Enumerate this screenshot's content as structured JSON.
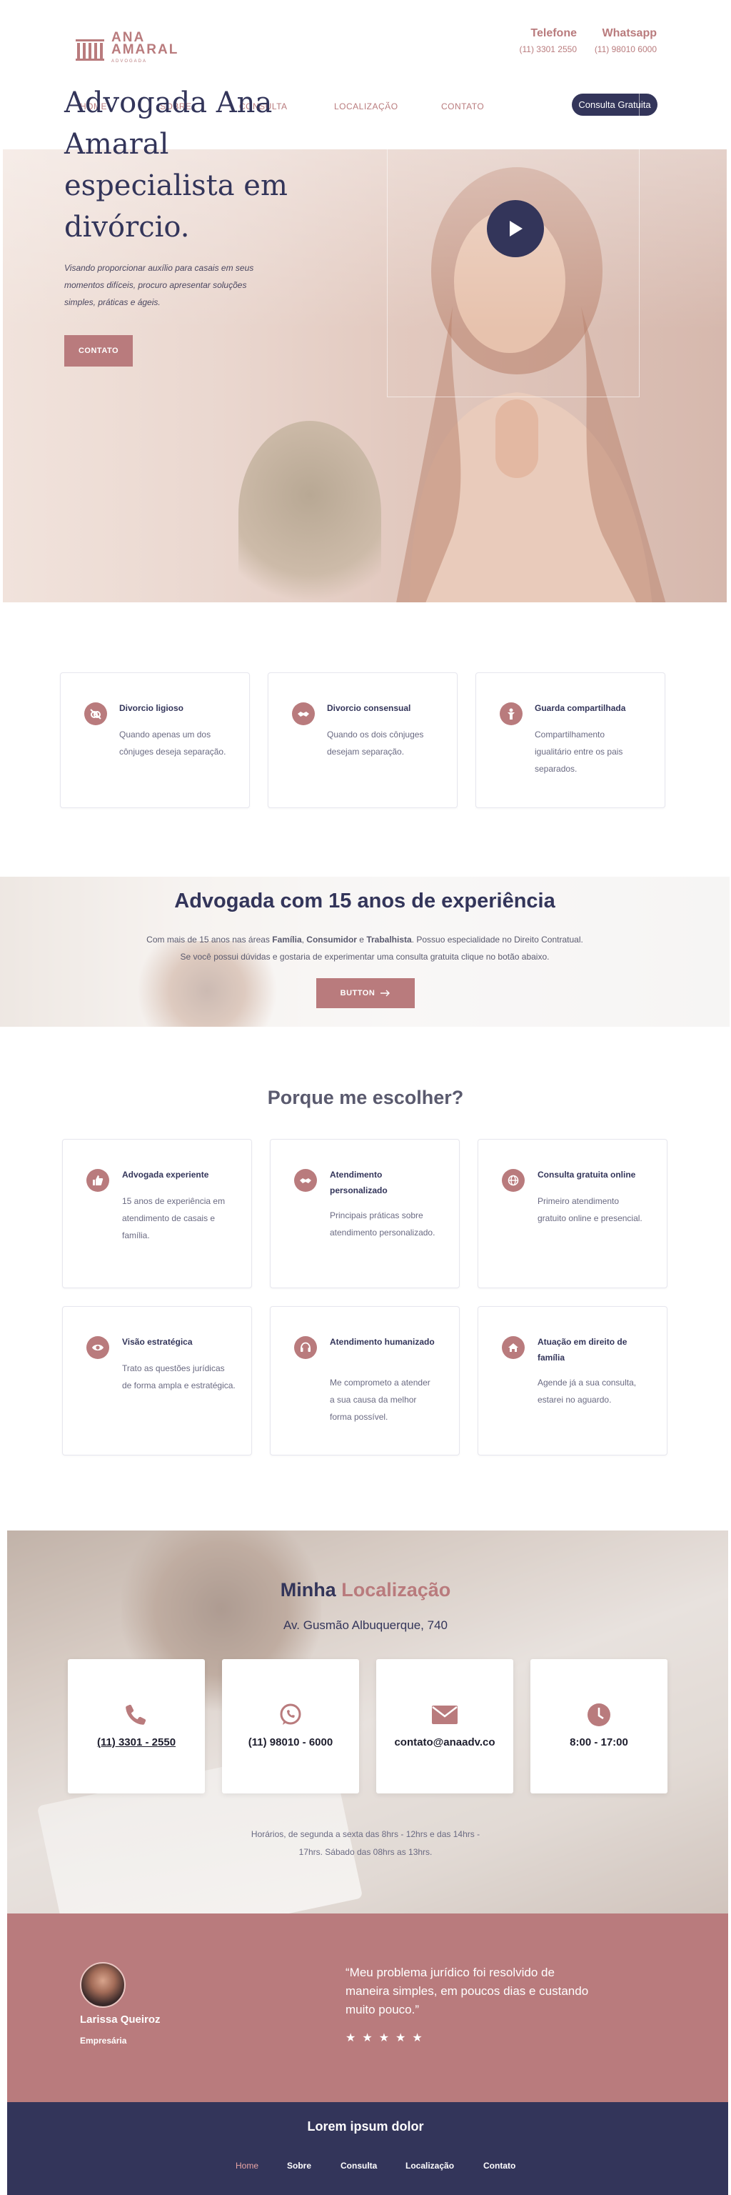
{
  "brand": {
    "line1": "ANA",
    "line2": "AMARAL",
    "line3": "ADVOGADA"
  },
  "contacts": [
    {
      "label": "Telefone",
      "value": "(11) 3301 2550"
    },
    {
      "label": "Whatsapp",
      "value": "(11) 98010 6000"
    }
  ],
  "nav": [
    "HOME",
    "SOBRE",
    "CONSULTA",
    "LOCALIZAÇÃO",
    "CONTATO"
  ],
  "nav_cta": "Consulta Gratuita",
  "hero": {
    "title": "Advogada Ana Amaral especialista em divórcio.",
    "subtitle": "Visando proporcionar auxílio para casais em seus momentos difíceis, procuro apresentar soluções simples, práticas e ágeis.",
    "button": "CONTATO",
    "play_icon": "play-icon"
  },
  "services": [
    {
      "icon": "no-rings-icon",
      "title": "Divorcio ligioso",
      "desc": "Quando apenas um dos cônjuges deseja separação."
    },
    {
      "icon": "handshake-icon",
      "title": "Divorcio consensual",
      "desc": "Quando os dois cônjuges desejam separação."
    },
    {
      "icon": "child-icon",
      "title": "Guarda compartilhada",
      "desc": "Compartilhamento igualitário entre os pais separados."
    }
  ],
  "experience": {
    "title": "Advogada com 15 anos de experiência",
    "line1_pre": "Com mais de 15 anos nas áreas ",
    "line1_b1": "Família",
    "line1_sep1": ", ",
    "line1_b2": "Consumidor",
    "line1_sep2": " e ",
    "line1_b3": "Trabalhista",
    "line1_post": ". Possuo especialidade no Direito Contratual.",
    "line2": "Se você possui dúvidas e gostaria de experimentar uma consulta gratuita clique no botão abaixo.",
    "button": "BUTTON",
    "button_icon": "arrow-right-icon"
  },
  "why": {
    "title": "Porque me escolher?",
    "items": [
      {
        "icon": "thumbs-up-icon",
        "title": "Advogada experiente",
        "desc": "15 anos de experiência em atendimento de casais e família."
      },
      {
        "icon": "handshake-icon",
        "title": "Atendimento personalizado",
        "desc": "Principais práticas sobre atendimento personalizado."
      },
      {
        "icon": "globe-icon",
        "title": "Consulta gratuita online",
        "desc": "Primeiro atendimento gratuito online e presencial."
      },
      {
        "icon": "eye-icon",
        "title": "Visão estratégica",
        "desc": "Trato as questões jurídicas de forma ampla e estratégica."
      },
      {
        "icon": "headset-icon",
        "title": "Atendimento humanizado",
        "desc": "Me comprometo a atender a sua causa da melhor forma possível."
      },
      {
        "icon": "home-icon",
        "title": "Atuação em direito de família",
        "desc": "Agende já a sua consulta, estarei no aguardo."
      }
    ]
  },
  "location": {
    "title_a": "Minha",
    "title_b": "Localização",
    "address": "Av. Gusmão Albuquerque, 740",
    "cards": [
      {
        "icon": "phone-icon",
        "text": "(11) 3301 - 2550"
      },
      {
        "icon": "whatsapp-icon",
        "text": "(11) 98010 - 6000"
      },
      {
        "icon": "envelope-icon",
        "text": "contato@anaadv.co"
      },
      {
        "icon": "clock-icon",
        "text": "8:00 - 17:00"
      }
    ],
    "hours_line1": "Horários, de segunda a sexta das 8hrs - 12hrs e das 14hrs -",
    "hours_line2": "17hrs. Sábado das 08hrs as 13hrs."
  },
  "testimonial": {
    "name": "Larissa Queiroz",
    "role": "Empresária",
    "quote": "“Meu problema jurídico foi resolvido de maneira simples, em poucos dias e custando muito pouco.”",
    "rating": 5
  },
  "footer": {
    "title": "Lorem ipsum dolor",
    "nav": [
      "Home",
      "Sobre",
      "Consulta",
      "Localização",
      "Contato"
    ]
  },
  "colors": {
    "accent": "#b97b7d",
    "navy": "#33355a",
    "white": "#ffffff"
  }
}
